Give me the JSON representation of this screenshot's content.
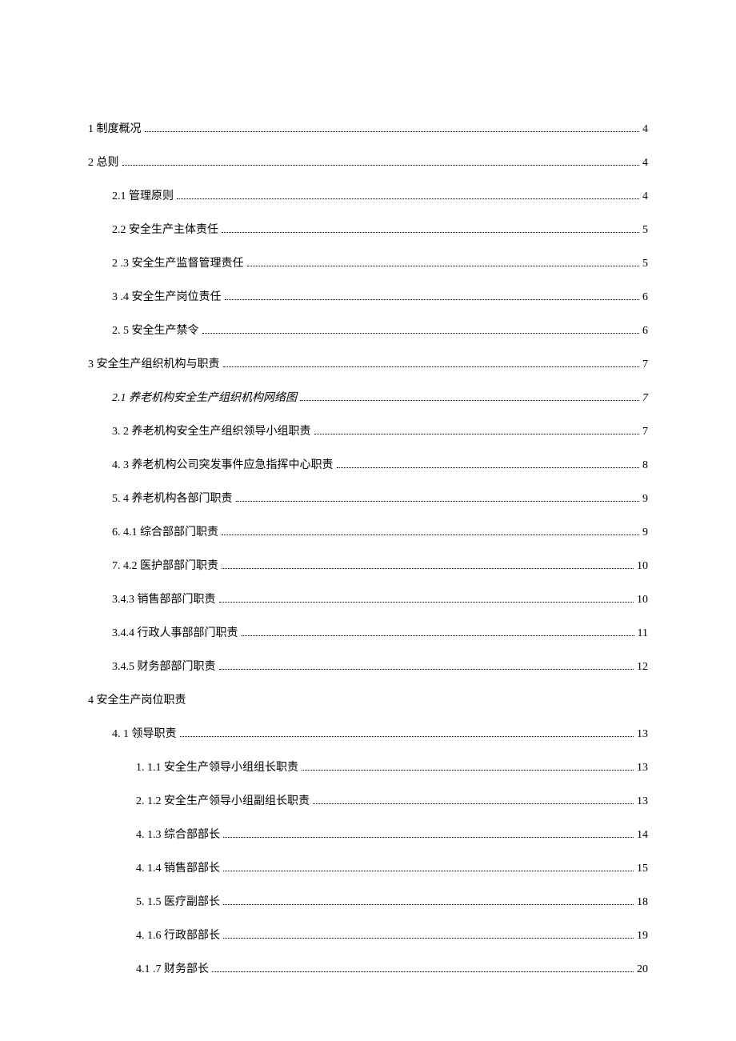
{
  "toc": [
    {
      "text": "1 制度概况",
      "page": "4",
      "indent": 0
    },
    {
      "text": "2 总则",
      "page": "4",
      "indent": 0
    },
    {
      "text": "2.1 管理原则",
      "page": "4",
      "indent": 1
    },
    {
      "text": "2.2 安全生产主体责任",
      "page": "5",
      "indent": 1
    },
    {
      "text": "2  .3 安全生产监督管理责任",
      "page": "5",
      "indent": 1
    },
    {
      "text": "3  .4 安全生产岗位责任",
      "page": "6",
      "indent": 1
    },
    {
      "text": "2.  5 安全生产禁令 ",
      "page": "6",
      "indent": 1
    },
    {
      "text": "3 安全生产组织机构与职责",
      "page": "7",
      "indent": 0
    },
    {
      "text": "2.1   养老机构安全生产组织机构网络图 ",
      "page": "7",
      "indent": 1,
      "italic": true
    },
    {
      "text": "3.  2 养老机构安全生产组织领导小组职责 ",
      "page": "7",
      "indent": 1
    },
    {
      "text": "4.  3 养老机构公司突发事件应急指挥中心职责 ",
      "page": "8",
      "indent": 1
    },
    {
      "text": "5.  4 养老机构各部门职责 ",
      "page": "9",
      "indent": 1
    },
    {
      "text": "6.  4.1 综合部部门职责 ",
      "page": "9",
      "indent": 1
    },
    {
      "text": "7.  4.2 医护部部门职责 ",
      "page": "10",
      "indent": 1
    },
    {
      "text": "3.4.3 销售部部门职责",
      "page": "10",
      "indent": 1
    },
    {
      "text": "3.4.4 行政人事部部门职责",
      "page": "11",
      "indent": 1
    },
    {
      "text": "3.4.5 财务部部门职责",
      "page": "12",
      "indent": 1
    },
    {
      "text": "4 安全生产岗位职责",
      "page": "",
      "indent": 0,
      "noPage": true
    },
    {
      "text": "4.  1 领导职责 ",
      "page": "13",
      "indent": 1
    },
    {
      "text": "1.  1.1 安全生产领导小组组长职责 ",
      "page": "13",
      "indent": 2
    },
    {
      "text": "2.  1.2 安全生产领导小组副组长职责 ",
      "page": "13",
      "indent": 2
    },
    {
      "text": "4.  1.3 综合部部长 ",
      "page": "14",
      "indent": 2
    },
    {
      "text": "4.  1.4 销售部部长 ",
      "page": "15",
      "indent": 2
    },
    {
      "text": "5.  1.5 医疗副部长 ",
      "page": "18",
      "indent": 2
    },
    {
      "text": "4.  1.6 行政部部长 ",
      "page": "19",
      "indent": 2
    },
    {
      "text": "4.1  .7 财务部长",
      "page": "20",
      "indent": 2
    }
  ]
}
